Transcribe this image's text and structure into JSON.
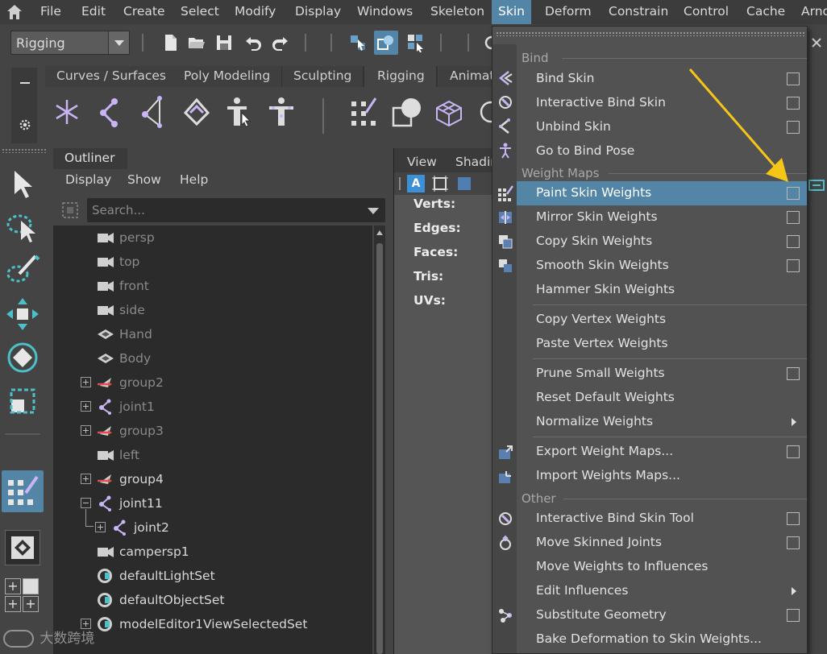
{
  "menubar": {
    "items": [
      "File",
      "Edit",
      "Create",
      "Select",
      "Modify",
      "Display",
      "Windows",
      "Skeleton",
      "Skin",
      "Deform",
      "Constrain",
      "Control",
      "Cache",
      "Arno"
    ],
    "active": "Skin"
  },
  "toolbar": {
    "mode": "Rigging"
  },
  "shelf": {
    "tabs": [
      "Curves / Surfaces",
      "Poly Modeling",
      "Sculpting",
      "Rigging",
      "Animat"
    ],
    "active_tab": "Rigging"
  },
  "outliner": {
    "tab": "Outliner",
    "menus": [
      "Display",
      "Show",
      "Help"
    ],
    "search_placeholder": "Search...",
    "rows": [
      {
        "label": "persp",
        "icon": "camera-icon",
        "dim": true
      },
      {
        "label": "top",
        "icon": "camera-icon",
        "dim": true
      },
      {
        "label": "front",
        "icon": "camera-icon",
        "dim": true
      },
      {
        "label": "side",
        "icon": "camera-icon",
        "dim": true
      },
      {
        "label": "Hand",
        "icon": "mesh-icon",
        "dim": true
      },
      {
        "label": "Body",
        "icon": "mesh-icon",
        "dim": true
      },
      {
        "label": "group2",
        "icon": "group-icon",
        "dim": true,
        "expander": "plus"
      },
      {
        "label": "joint1",
        "icon": "joint-icon",
        "dim": true,
        "expander": "plus"
      },
      {
        "label": "group3",
        "icon": "group-icon",
        "dim": true,
        "expander": "plus"
      },
      {
        "label": "left",
        "icon": "camera-icon",
        "dim": true
      },
      {
        "label": "group4",
        "icon": "group-icon",
        "dim": false,
        "expander": "plus"
      },
      {
        "label": "joint11",
        "icon": "joint-icon",
        "dim": false,
        "expander": "minus"
      },
      {
        "label": "joint2",
        "icon": "joint-icon",
        "dim": false,
        "expander": "plus",
        "child": true
      },
      {
        "label": "campersp1",
        "icon": "camera-icon",
        "dim": false
      },
      {
        "label": "defaultLightSet",
        "icon": "set-icon",
        "dim": false
      },
      {
        "label": "defaultObjectSet",
        "icon": "set-icon",
        "dim": false
      },
      {
        "label": "modelEditor1ViewSelectedSet",
        "icon": "set-icon",
        "dim": false,
        "expander": "plus"
      }
    ]
  },
  "viewport": {
    "menus": [
      "View",
      "Shadin"
    ],
    "hud": [
      "Verts:",
      "Edges:",
      "Faces:",
      "Tris:",
      "UVs:"
    ]
  },
  "skin_menu": {
    "sections": {
      "bind": "Bind",
      "weight_maps": "Weight Maps",
      "other": "Other"
    },
    "items": [
      {
        "label": "Bind Skin",
        "option": true
      },
      {
        "label": "Interactive Bind Skin",
        "option": true
      },
      {
        "label": "Unbind Skin",
        "option": true
      },
      {
        "label": "Go to Bind Pose",
        "option": false
      },
      {
        "label": "Paint Skin Weights",
        "option": true,
        "highlight": true
      },
      {
        "label": "Mirror Skin Weights",
        "option": true
      },
      {
        "label": "Copy Skin Weights",
        "option": true
      },
      {
        "label": "Smooth Skin Weights",
        "option": true
      },
      {
        "label": "Hammer Skin Weights",
        "option": false
      },
      {
        "label": "Copy Vertex Weights",
        "option": false
      },
      {
        "label": "Paste Vertex Weights",
        "option": false
      },
      {
        "label": "Prune Small Weights",
        "option": true
      },
      {
        "label": "Reset Default Weights",
        "option": false
      },
      {
        "label": "Normalize Weights",
        "submenu": true
      },
      {
        "label": "Export Weight Maps...",
        "option": true
      },
      {
        "label": "Import Weights Maps...",
        "option": false
      },
      {
        "label": "Interactive Bind Skin Tool",
        "option": true
      },
      {
        "label": "Move Skinned Joints",
        "option": true
      },
      {
        "label": "Move Weights to Influences",
        "option": false
      },
      {
        "label": "Edit Influences",
        "submenu": true
      },
      {
        "label": "Substitute Geometry",
        "option": true
      },
      {
        "label": "Bake Deformation to Skin Weights...",
        "option": false
      }
    ]
  },
  "watermark": "大数跨境",
  "colors": {
    "accent": "#5285a6",
    "menu_bg": "#525252",
    "outliner_bg": "#2b2b2b",
    "arrow": "#f5c518",
    "icon_lavender": "#c9b5f5"
  }
}
